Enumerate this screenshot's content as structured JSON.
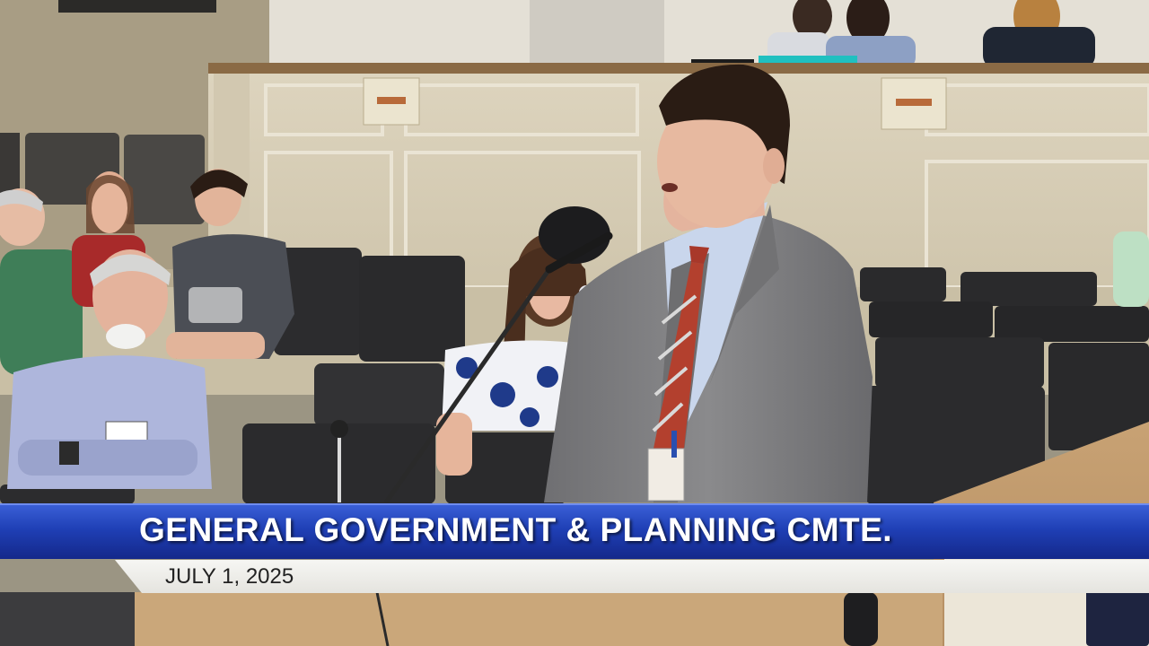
{
  "broadcast": {
    "headline": "GENERAL GOVERNMENT & PLANNING CMTE.",
    "date": "JULY 1, 2025"
  },
  "scene": {
    "colors": {
      "wall": "#d8cfb8",
      "wall_panel_line": "#eae4d4",
      "dais_top": "#8a6a45",
      "suit": "#7e7e80",
      "shirt": "#c9d6ec",
      "tie": "#b3402e",
      "hair": "#2a1c14",
      "skin": "#e7b9a0",
      "chair": "#2c2c2e",
      "headline_bar": "#1f3fb5",
      "date_bar": "#ecebe6"
    }
  }
}
